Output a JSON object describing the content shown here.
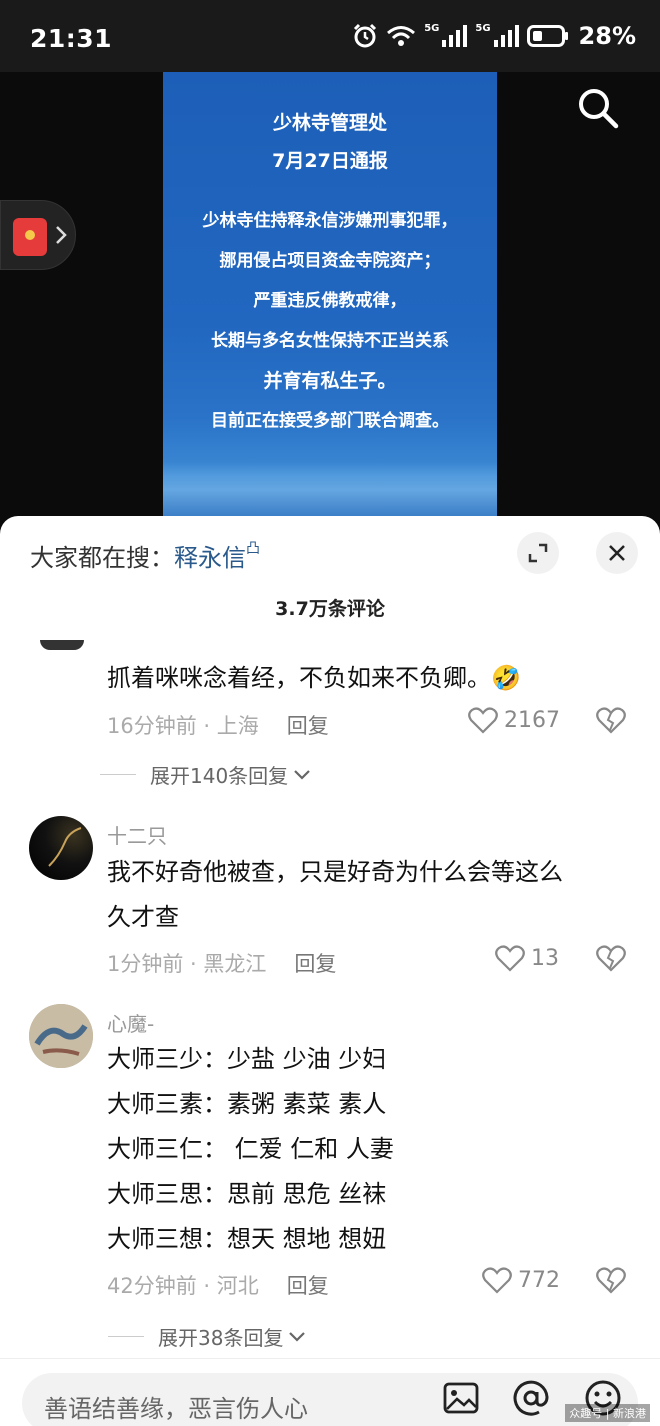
{
  "status": {
    "time": "21:31",
    "network_1": "5G",
    "network_2": "5G",
    "battery": "28%"
  },
  "poster": {
    "title": "少林寺管理处",
    "date": "7月27日通报",
    "lines": [
      "少林寺住持释永信涉嫌刑事犯罪，",
      "挪用侵占项目资金寺院资产；",
      "严重违反佛教戒律，",
      "长期与多名女性保持不正当关系",
      "并育有私生子。",
      "目前正在接受多部门联合调查。"
    ]
  },
  "sheet": {
    "hot_search_prefix": "大家都在搜：",
    "hot_search_keyword": "释永信",
    "comment_count_title": "3.7万条评论"
  },
  "comments": [
    {
      "nickname": "",
      "text": "抓着咪咪念着经，不负如来不负卿。🤣",
      "time_location": "16分钟前 · 上海",
      "reply_label": "回复",
      "likes": "2167",
      "expand": "展开140条回复"
    },
    {
      "nickname": "十二只",
      "text_lines": [
        "我不好奇他被查，只是好奇为什么会等这么",
        "久才查"
      ],
      "time_location": "1分钟前 · 黑龙江",
      "reply_label": "回复",
      "likes": "13"
    },
    {
      "nickname": "心魔-",
      "text_lines": [
        "大师三少：少盐 少油 少妇",
        "大师三素：素粥 素菜 素人",
        "大师三仁： 仁爱 仁和 人妻",
        "大师三思：思前 思危 丝袜",
        "大师三想：想天 想地 想妞"
      ],
      "time_location": "42分钟前 · 河北",
      "reply_label": "回复",
      "likes": "772",
      "expand": "展开38条回复"
    }
  ],
  "input": {
    "placeholder": "善语结善缘，恶言伤人心"
  },
  "watermark": "众趣号 | 新浪港",
  "colors": {
    "poster_blue": "#2167c0",
    "keyword_blue": "#2a5a8c",
    "redpacket": "#e53b3b"
  }
}
